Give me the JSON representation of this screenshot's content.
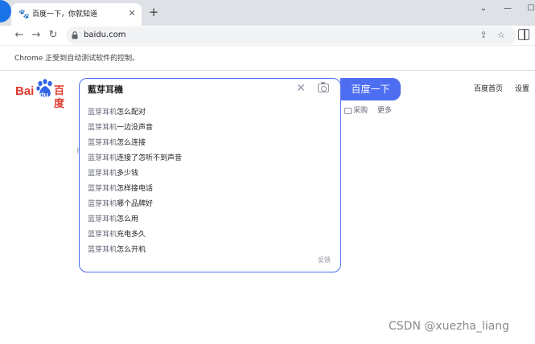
{
  "browser": {
    "tab_title": "百度一下，你就知道",
    "tab_close": "✕",
    "new_tab": "+",
    "window_controls": {
      "dropdown": "⌄",
      "minimize": "—",
      "maximize": "☐"
    },
    "url": "baidu.com",
    "nav": {
      "back": "←",
      "forward": "→",
      "reload": "↻"
    },
    "omnibox_icons": {
      "share": "⇪",
      "bookmark": "☆"
    },
    "automation_notice": "Chrome 正受到自动测试软件的控制。"
  },
  "page": {
    "logo": {
      "left": "Bai",
      "paw": "du",
      "right": "百度"
    },
    "search": {
      "query": "藍芽耳機",
      "button_label": "百度一下",
      "clear_icon": "✕",
      "feedback_label": "反馈",
      "suggestions": [
        {
          "prefix": "蓝芽耳机",
          "rest": "怎么配对"
        },
        {
          "prefix": "蓝芽耳机",
          "rest": "一边没声音"
        },
        {
          "prefix": "蓝芽耳机",
          "rest": "怎么连接"
        },
        {
          "prefix": "蓝芽耳机",
          "rest": "连接了怎听不到声音"
        },
        {
          "prefix": "蓝芽耳机",
          "rest": "多少钱"
        },
        {
          "prefix": "蓝芽耳机",
          "rest": "怎样接电话"
        },
        {
          "prefix": "蓝芽耳机",
          "rest": "哪个品牌好"
        },
        {
          "prefix": "蓝芽耳机",
          "rest": "怎么用"
        },
        {
          "prefix": "蓝芽耳机",
          "rest": "充电多久"
        },
        {
          "prefix": "蓝芽耳机",
          "rest": "怎么开机"
        }
      ]
    },
    "behind_links": {
      "purchase": "采购",
      "more": "更多"
    },
    "behind_hint": "找",
    "top_links": {
      "home": "百度首页",
      "settings": "设置"
    }
  },
  "watermark": "CSDN @xuezha_liang",
  "colors": {
    "accent": "#4e6ef2",
    "brand_red": "#de3a2c",
    "tabstrip": "#dee1e6"
  }
}
